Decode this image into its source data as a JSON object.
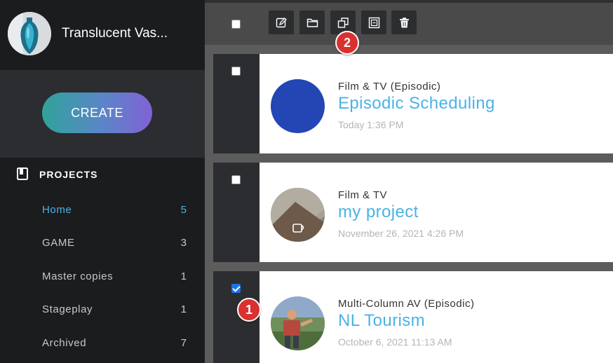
{
  "profile": {
    "name": "Translucent Vas..."
  },
  "create_button": {
    "label": "CREATE"
  },
  "projects": {
    "title": "PROJECTS",
    "items": [
      {
        "label": "Home",
        "count": "5"
      },
      {
        "label": "GAME",
        "count": "3"
      },
      {
        "label": "Master copies",
        "count": "1"
      },
      {
        "label": "Stageplay",
        "count": "1"
      },
      {
        "label": "Archived",
        "count": "7"
      }
    ]
  },
  "toolbar": {
    "buttons": [
      "edit-icon",
      "folder-icon",
      "duplicate-icon",
      "archive-icon",
      "trash-icon"
    ]
  },
  "rows": [
    {
      "type": "Film & TV (Episodic)",
      "title": "Episodic Scheduling",
      "date": "Today 1:36 PM",
      "checked": false
    },
    {
      "type": "Film & TV",
      "title": "my project",
      "date": "November 26, 2021 4:26 PM",
      "checked": false
    },
    {
      "type": "Multi-Column AV (Episodic)",
      "title": "NL Tourism",
      "date": "October 6, 2021 11:13 AM",
      "checked": true
    }
  ],
  "annotations": {
    "badge_1": "1",
    "badge_2": "2"
  },
  "colors": {
    "accent": "#4ab3e6",
    "sidebar": "#1b1c1e",
    "episodic_thumb": "#2346b4",
    "badge": "#d9312f"
  }
}
